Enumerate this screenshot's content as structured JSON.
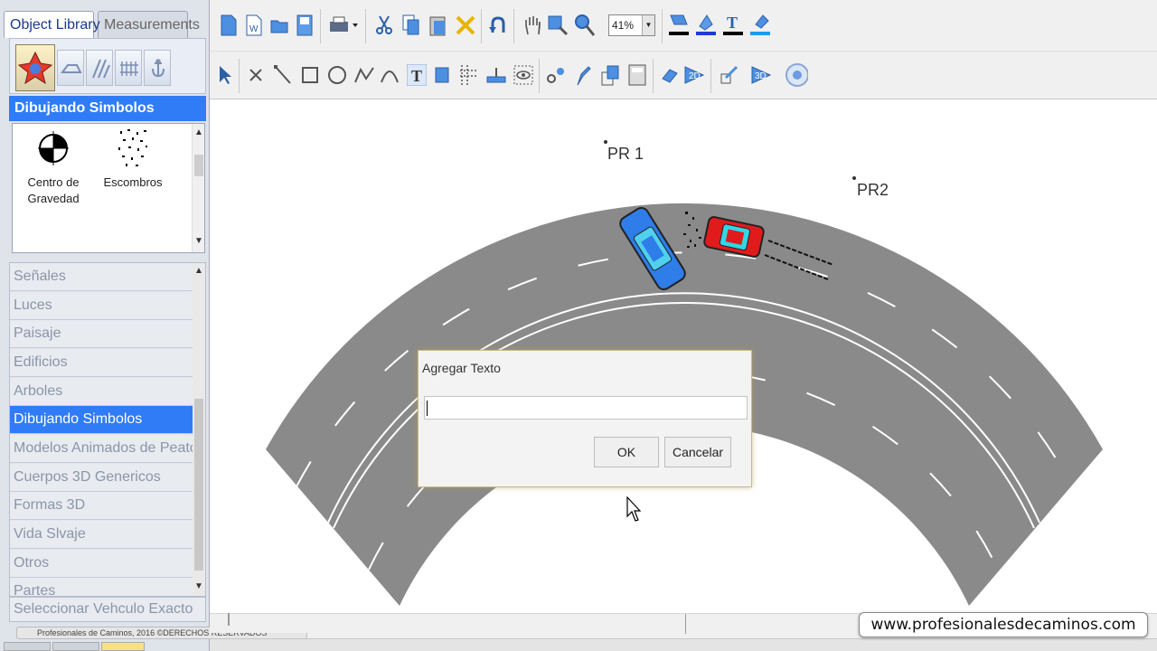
{
  "panel": {
    "tabs": {
      "object_library": "Object Library",
      "measurements": "Measurements"
    },
    "section_title": "Dibujando Simbolos",
    "symbols": [
      {
        "label": "Centro de Gravedad",
        "icon": "center-of-gravity-icon"
      },
      {
        "label": "Escombros",
        "icon": "debris-icon"
      }
    ],
    "categories": [
      {
        "label": "Señales",
        "selected": false
      },
      {
        "label": "Luces",
        "selected": false
      },
      {
        "label": "Paisaje",
        "selected": false
      },
      {
        "label": "Edificios",
        "selected": false
      },
      {
        "label": "Arboles",
        "selected": false
      },
      {
        "label": "Dibujando Simbolos",
        "selected": true
      },
      {
        "label": "Modelos Animados de Peatones",
        "selected": false
      },
      {
        "label": "Cuerpos 3D Genericos",
        "selected": false
      },
      {
        "label": "Formas 3D",
        "selected": false
      },
      {
        "label": "Vida Slvaje",
        "selected": false
      },
      {
        "label": "Otros",
        "selected": false
      },
      {
        "label": "Partes",
        "selected": false
      }
    ],
    "select_vehicle": "Seleccionar Vehculo Exacto",
    "copyright": "Profesionales de Caminos, 2016 ©DERECHOS RESERVADOS"
  },
  "toolbar": {
    "zoom": "41%"
  },
  "canvas": {
    "labels": {
      "pr1": "PR 1",
      "pr2": "PR2"
    },
    "colors": {
      "road": "#8a8a8a",
      "car_blue": "#2e7de8",
      "car_red": "#e11b1b"
    }
  },
  "dialog": {
    "title": "Agregar Texto",
    "input_value": "",
    "ok": "OK",
    "cancel": "Cancelar"
  },
  "footer": {
    "website": "www.profesionalesdecaminos.com"
  }
}
